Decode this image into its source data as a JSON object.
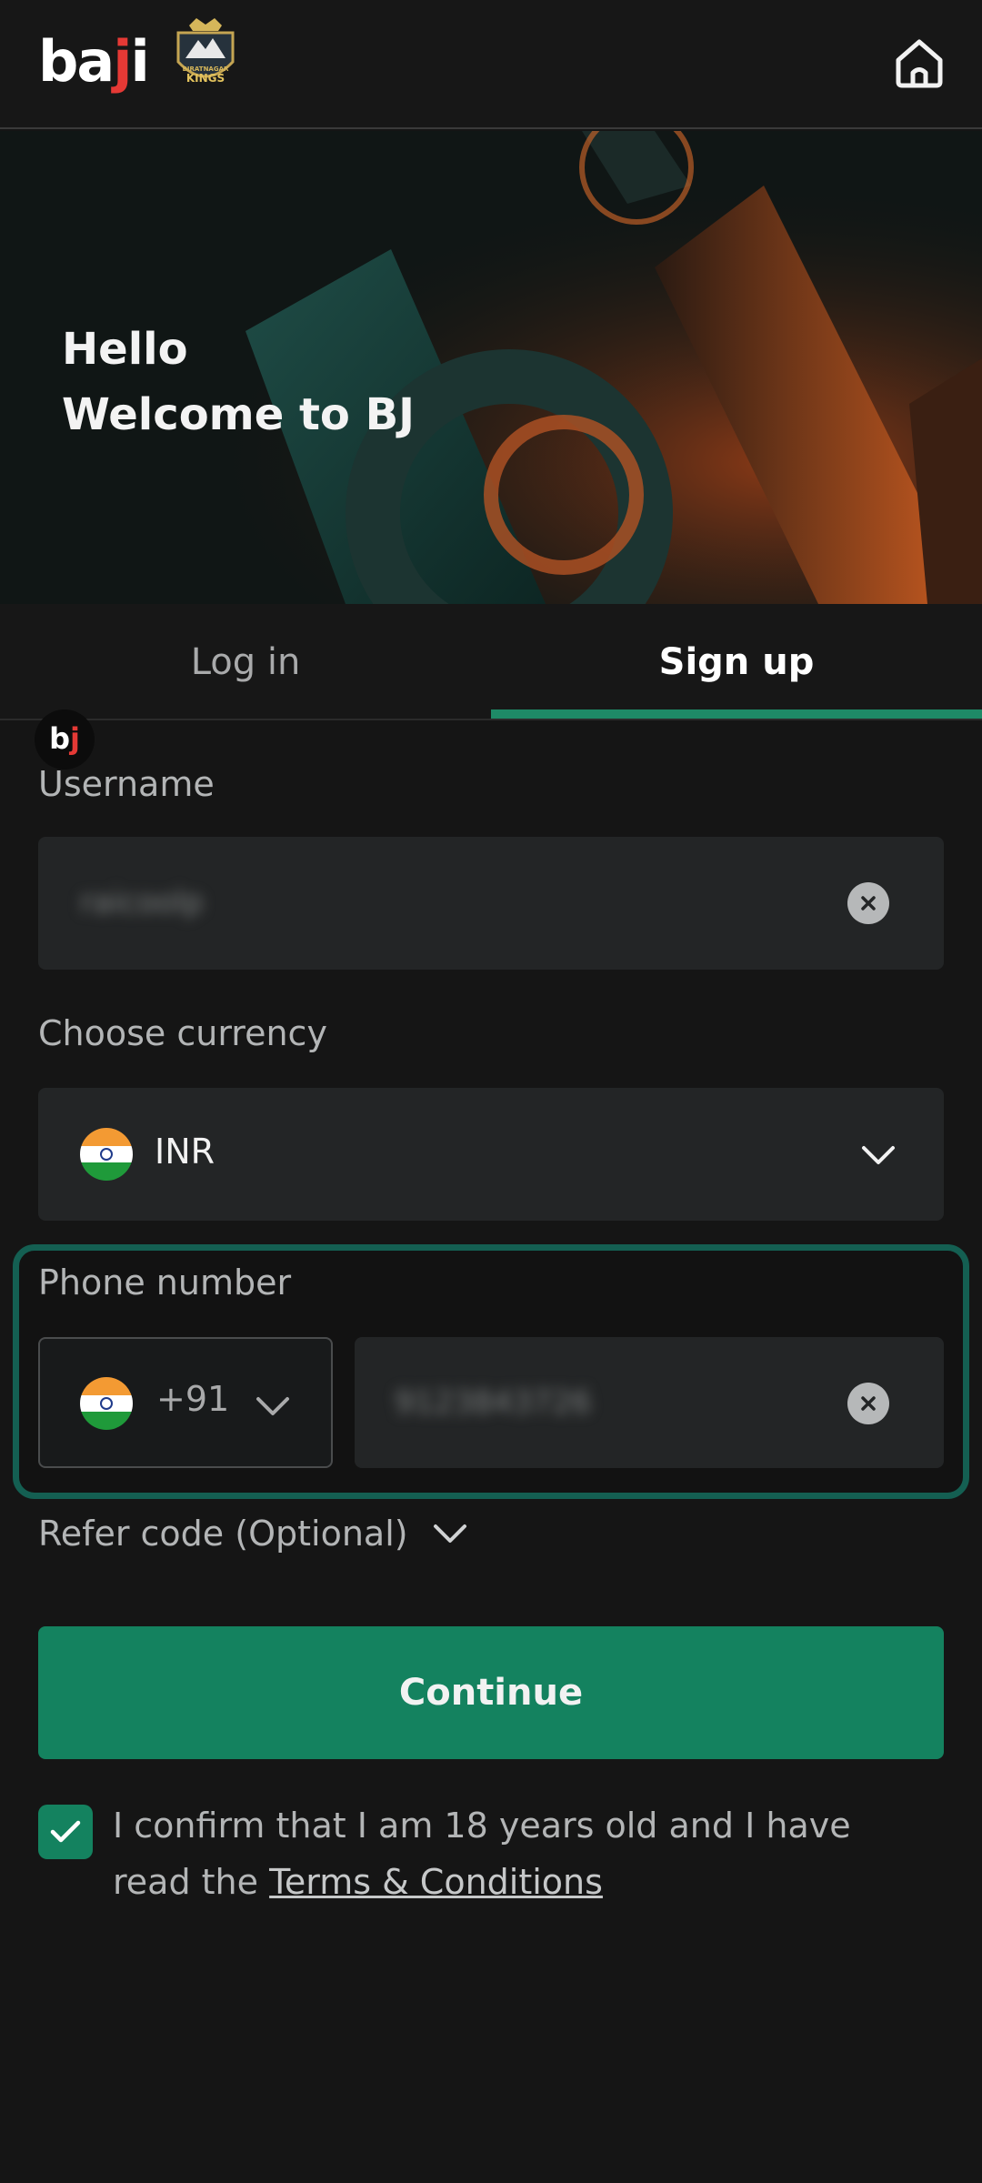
{
  "header": {
    "logo_text_a": "ba",
    "logo_text_j": "j",
    "logo_text_i": "i",
    "badge_top_text": "BIRATNAGAR",
    "badge_text": "KINGS"
  },
  "hero": {
    "line1": "Hello",
    "line2": "Welcome to BJ"
  },
  "tabs": {
    "login_label": "Log in",
    "signup_label": "Sign up",
    "active": "signup"
  },
  "mini_logo": {
    "b": "b",
    "j": "j"
  },
  "form": {
    "username_label": "Username",
    "username_value": "raicoolp",
    "currency_label": "Choose currency",
    "currency_value": "INR",
    "phone_label": "Phone number",
    "country_code": "+91",
    "phone_value": "9123843726",
    "refer_label": "Refer code (Optional)",
    "continue_label": "Continue",
    "confirm_text": "I confirm that I am 18 years old and I have read the ",
    "terms_link": "Terms & Conditions",
    "age_confirmed": true
  },
  "colors": {
    "accent": "#14825f",
    "tab_underline": "#1e8a67",
    "phone_frame": "#145f52",
    "background": "#151515",
    "logo_red": "#e53935"
  },
  "icons": {
    "home": "home-icon",
    "clear": "close-circle-icon",
    "chevron": "chevron-down-icon",
    "flag": "india-flag-icon",
    "check": "check-icon"
  }
}
